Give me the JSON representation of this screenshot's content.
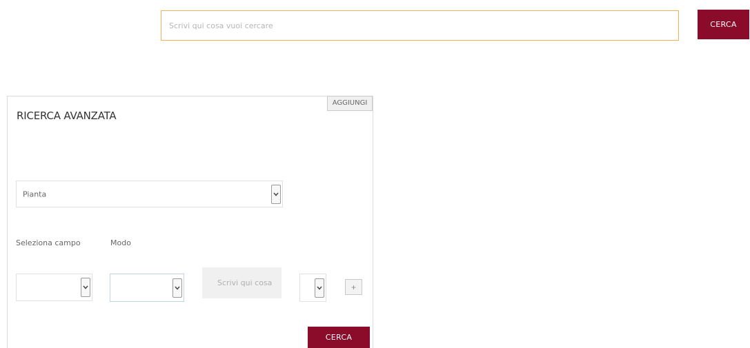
{
  "top_search": {
    "placeholder": "Scrivi qui cosa vuoi cercare",
    "button_label": "CERCA"
  },
  "advanced": {
    "title": "RICERCA AVANZATA",
    "add_label": "AGGIUNGI",
    "category_select": {
      "value": "Pianta",
      "icon": "chevron-down-icon"
    },
    "field_label": "Seleziona campo",
    "mode_label": "Modo",
    "field_select": {
      "value": ""
    },
    "mode_select": {
      "value": ""
    },
    "value_input": {
      "placeholder": "Scrivi qui cosa vu"
    },
    "operator_select": {
      "value": ""
    },
    "plus_label": "+",
    "search_label": "CERCA"
  },
  "colors": {
    "accent": "#8a0b2a",
    "search_border": "#f0b255",
    "panel_border": "#dcdcdc"
  }
}
